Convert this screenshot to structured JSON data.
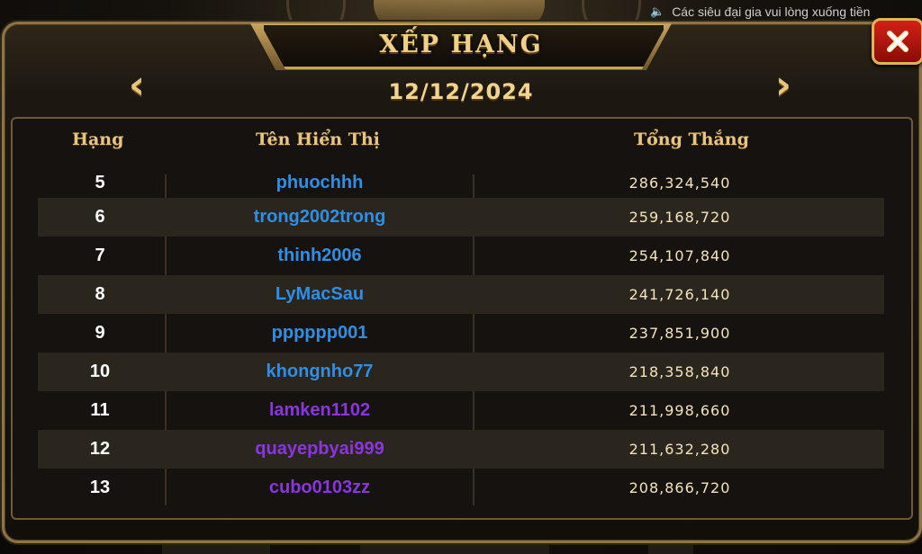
{
  "ticker": {
    "text": "Các siêu đại gia vui lòng xuống tiền"
  },
  "header": {
    "title": "XẾP HẠNG",
    "date": "12/12/2024",
    "prev_icon": "chevron-left-icon",
    "next_icon": "chevron-right-icon",
    "close_icon": "close-icon"
  },
  "table": {
    "columns": [
      "Hạng",
      "Tên Hiển Thị",
      "Tổng Thắng"
    ],
    "rows": [
      {
        "rank": "5",
        "name": "phuochhh",
        "total": "286,324,540",
        "name_color": "#2d8fe6"
      },
      {
        "rank": "6",
        "name": "trong2002trong",
        "total": "259,168,720",
        "name_color": "#2d8fe6"
      },
      {
        "rank": "7",
        "name": "thinh2006",
        "total": "254,107,840",
        "name_color": "#2d8fe6"
      },
      {
        "rank": "8",
        "name": "LyMacSau",
        "total": "241,726,140",
        "name_color": "#2d8fe6"
      },
      {
        "rank": "9",
        "name": "pppppp001",
        "total": "237,851,900",
        "name_color": "#2d8fe6"
      },
      {
        "rank": "10",
        "name": "khongnho77",
        "total": "218,358,840",
        "name_color": "#2d8fe6"
      },
      {
        "rank": "11",
        "name": "lamken1102",
        "total": "211,998,660",
        "name_color": "#8a35e0"
      },
      {
        "rank": "12",
        "name": "quayepbyai999",
        "total": "211,632,280",
        "name_color": "#8a35e0"
      },
      {
        "rank": "13",
        "name": "cubo0103zz",
        "total": "208,866,720",
        "name_color": "#8a35e0"
      }
    ]
  },
  "colors": {
    "gold": "#e8c57e",
    "close_red": "#d32116"
  }
}
